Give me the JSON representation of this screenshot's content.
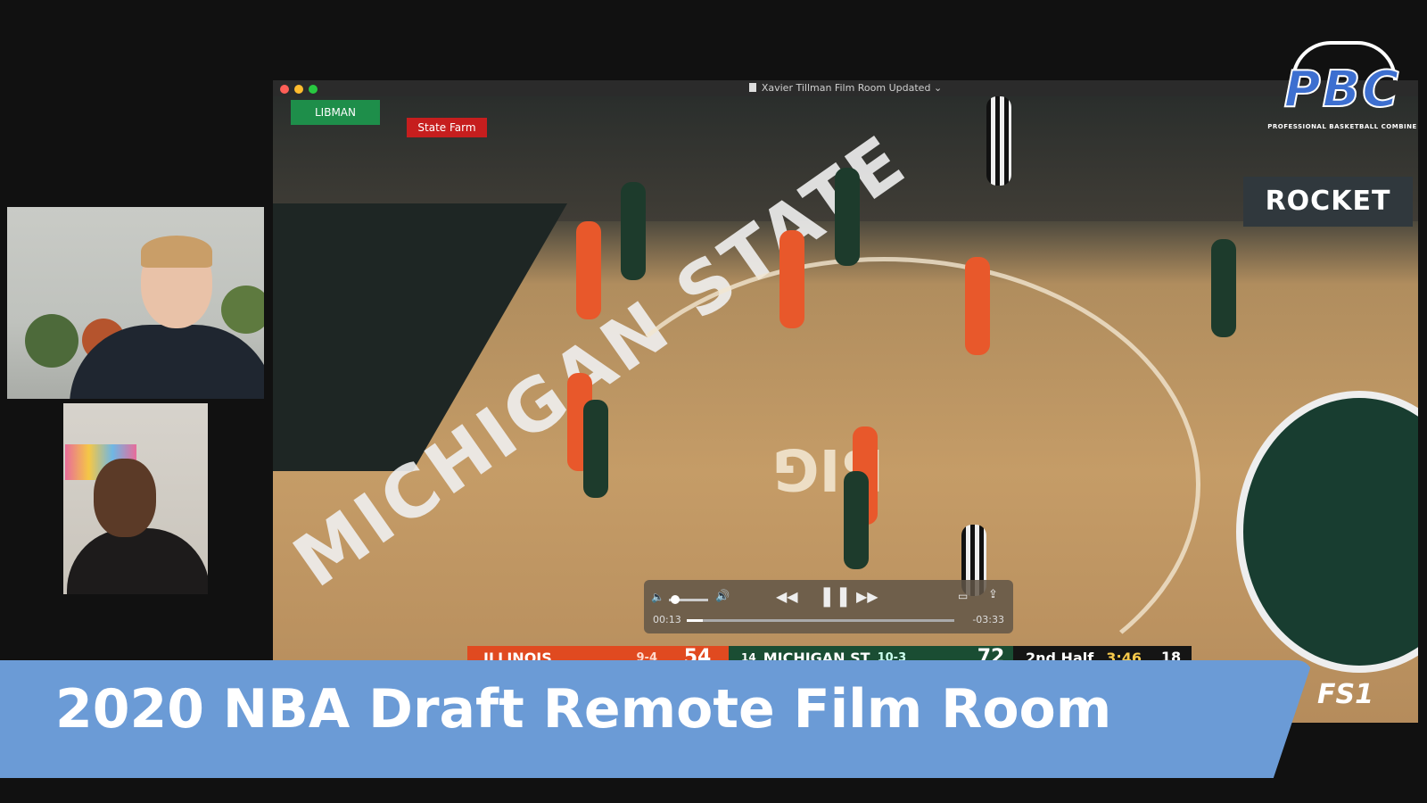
{
  "window": {
    "title": "Xavier Tillman Film Room Updated"
  },
  "video": {
    "ads": {
      "rocket": "ROCKET",
      "statefarm": "State Farm",
      "libman": "LIBMAN"
    },
    "court_text": "MICHIGAN STATE",
    "conference_logo": "BIG"
  },
  "player_controls": {
    "elapsed": "00:13",
    "remaining": "-03:33",
    "progress_fraction": 0.06,
    "state": "paused"
  },
  "scorebug": {
    "team1": {
      "name": "ILLINOIS",
      "record": "9-4",
      "score": "54"
    },
    "team2": {
      "rank": "14",
      "name": "MICHIGAN ST",
      "record": "10-3",
      "score": "72"
    },
    "period": "2nd Half",
    "clock": "3:46",
    "shot_clock": "18"
  },
  "network": "FS1",
  "branding": {
    "logo_text": "PBC",
    "logo_subtitle": "PROFESSIONAL BASKETBALL COMBINE"
  },
  "lower_third": {
    "title": "2020 NBA Draft Remote Film Room"
  },
  "colors": {
    "lower_third_bg": "#6b9bd6",
    "illinois_orange": "#e04a20",
    "msu_green": "#1a4d33",
    "pbc_blue": "#3d6fd0"
  }
}
